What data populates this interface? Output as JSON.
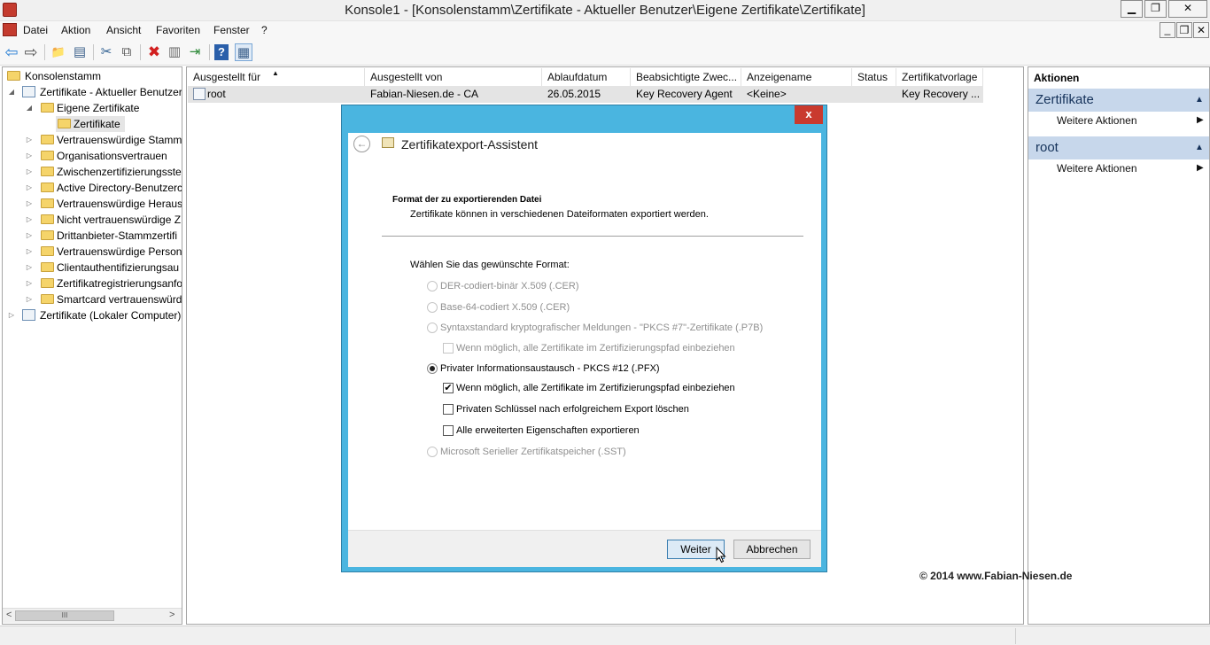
{
  "window": {
    "title": "Konsole1 - [Konsolenstamm\\Zertifikate - Aktueller Benutzer\\Eigene Zertifikate\\Zertifikate]",
    "minimize": "▁",
    "restore": "❐",
    "close": "✕",
    "inner_minimize": "_",
    "inner_restore": "❐",
    "inner_close": "✕"
  },
  "menu": [
    "Datei",
    "Aktion",
    "Ansicht",
    "Favoriten",
    "Fenster",
    "?"
  ],
  "toolbar": {
    "back": "⇦",
    "forward": "⇨",
    "up": "📁",
    "show_tree": "▤",
    "cut": "✂",
    "copy": "⧉",
    "delete": "✖",
    "properties": "▥",
    "export": "⇥",
    "help": "?",
    "action_pane": "▦"
  },
  "tree": {
    "root": "Konsolenstamm",
    "user_store": "Zertifikate - Aktueller Benutzer",
    "personal": "Eigene Zertifikate",
    "certificates": "Zertifikate",
    "children": [
      "Vertrauenswürdige Stamm",
      "Organisationsvertrauen",
      "Zwischenzertifizierungsstel",
      "Active Directory-Benutzerc",
      "Vertrauenswürdige Heraus",
      "Nicht vertrauenswürdige Z",
      "Drittanbieter-Stammzertifi",
      "Vertrauenswürdige Persone",
      "Clientauthentifizierungsau",
      "Zertifikatregistrierungsanfo",
      "Smartcard vertrauenswürd"
    ],
    "computer_store": "Zertifikate (Lokaler Computer)",
    "scroll_left": "<",
    "scroll_grip": "III",
    "scroll_right": ">"
  },
  "list": {
    "columns": [
      "Ausgestellt für",
      "Ausgestellt von",
      "Ablaufdatum",
      "Beabsichtigte Zwec...",
      "Anzeigename",
      "Status",
      "Zertifikatvorlage"
    ],
    "sort_indicator": "▲",
    "rows": [
      [
        "root",
        "Fabian-Niesen.de - CA",
        "26.05.2015",
        "Key Recovery Agent",
        "<Keine>",
        "",
        "Key Recovery ..."
      ]
    ]
  },
  "actions": {
    "title": "Aktionen",
    "sections": [
      {
        "header": "Zertifikate",
        "item": "Weitere Aktionen"
      },
      {
        "header": "root",
        "item": "Weitere Aktionen"
      }
    ],
    "collapse": "▲",
    "more": "▶"
  },
  "dialog": {
    "close": "x",
    "back": "←",
    "title": "Zertifikatexport-Assistent",
    "heading": "Format der zu exportierenden Datei",
    "subheading": "Zertifikate können in verschiedenen Dateiformaten exportiert werden.",
    "prompt": "Wählen Sie das gewünschte Format:",
    "options": [
      "DER-codiert-binär X.509 (.CER)",
      "Base-64-codiert X.509 (.CER)",
      "Syntaxstandard kryptografischer Meldungen - \"PKCS #7\"-Zertifikate (.P7B)",
      "Wenn möglich, alle Zertifikate im Zertifizierungspfad einbeziehen",
      "Privater Informationsaustausch - PKCS #12 (.PFX)",
      "Wenn möglich, alle Zertifikate im Zertifizierungspfad einbeziehen",
      "Privaten Schlüssel nach erfolgreichem Export löschen",
      "Alle erweiterten Eigenschaften exportieren",
      "Microsoft Serieller Zertifikatspeicher (.SST)"
    ],
    "checkmark": "✔",
    "next": "Weiter",
    "cancel": "Abbrechen"
  },
  "copyright": "© 2014 www.Fabian-Niesen.de"
}
